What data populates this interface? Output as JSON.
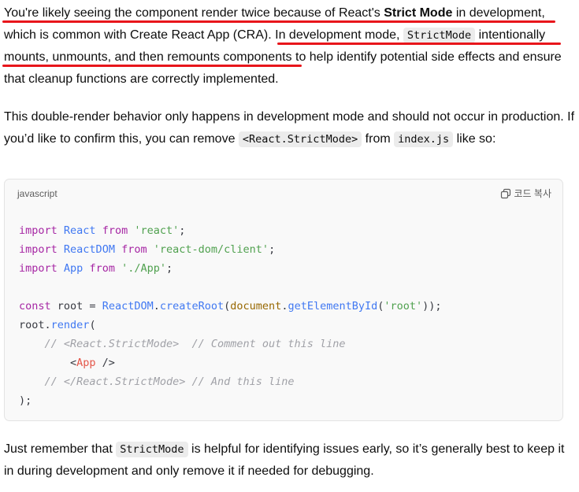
{
  "paragraph1": {
    "t1": "You're likely seeing the component render twice because of React's ",
    "bold": "Strict Mode",
    "t2": " in development, which is common with Create React App (CRA). ",
    "t3": "In development mode, ",
    "code": "StrictMode",
    "t4": " intentionally mounts, unmounts, and then remounts components",
    "t5": " to help identify potential side effects and ensure that cleanup functions are correctly implemented."
  },
  "paragraph2": {
    "t1": "This double-render behavior only happens in development mode and should not occur in production. If you’d like to confirm this, you can remove ",
    "code1": "<React.StrictMode>",
    "t2": " from ",
    "code2": "index.js",
    "t3": " like so:"
  },
  "codeblock": {
    "language": "javascript",
    "copy_label": "코드 복사",
    "copy_icon": "copy-icon",
    "tokens": {
      "import": "import",
      "from": "from",
      "const": "const",
      "React": "React",
      "ReactDOM": "ReactDOM",
      "App": "App",
      "str_react": "'react'",
      "str_reactdom": "'react-dom/client'",
      "str_app": "'./App'",
      "root": "root",
      "eq": " = ",
      "createRoot": "createRoot",
      "document": "document",
      "getElementById": "getElementById",
      "str_root": "'root'",
      "render": "render",
      "comment1": "// <React.StrictMode>  // Comment out this line",
      "comment2": "// </React.StrictMode> // And this line"
    }
  },
  "paragraph3": {
    "t1": "Just remember that ",
    "code": "StrictMode",
    "t2": " is helpful for identifying issues early, so it’s generally best to keep it in during development and only remove it if needed for debugging."
  },
  "colors": {
    "underline": "#e8151b",
    "keyword": "#a626a4",
    "function": "#4078f2",
    "string": "#50a14f",
    "comment": "#a0a1a7",
    "tag": "#e45649"
  }
}
